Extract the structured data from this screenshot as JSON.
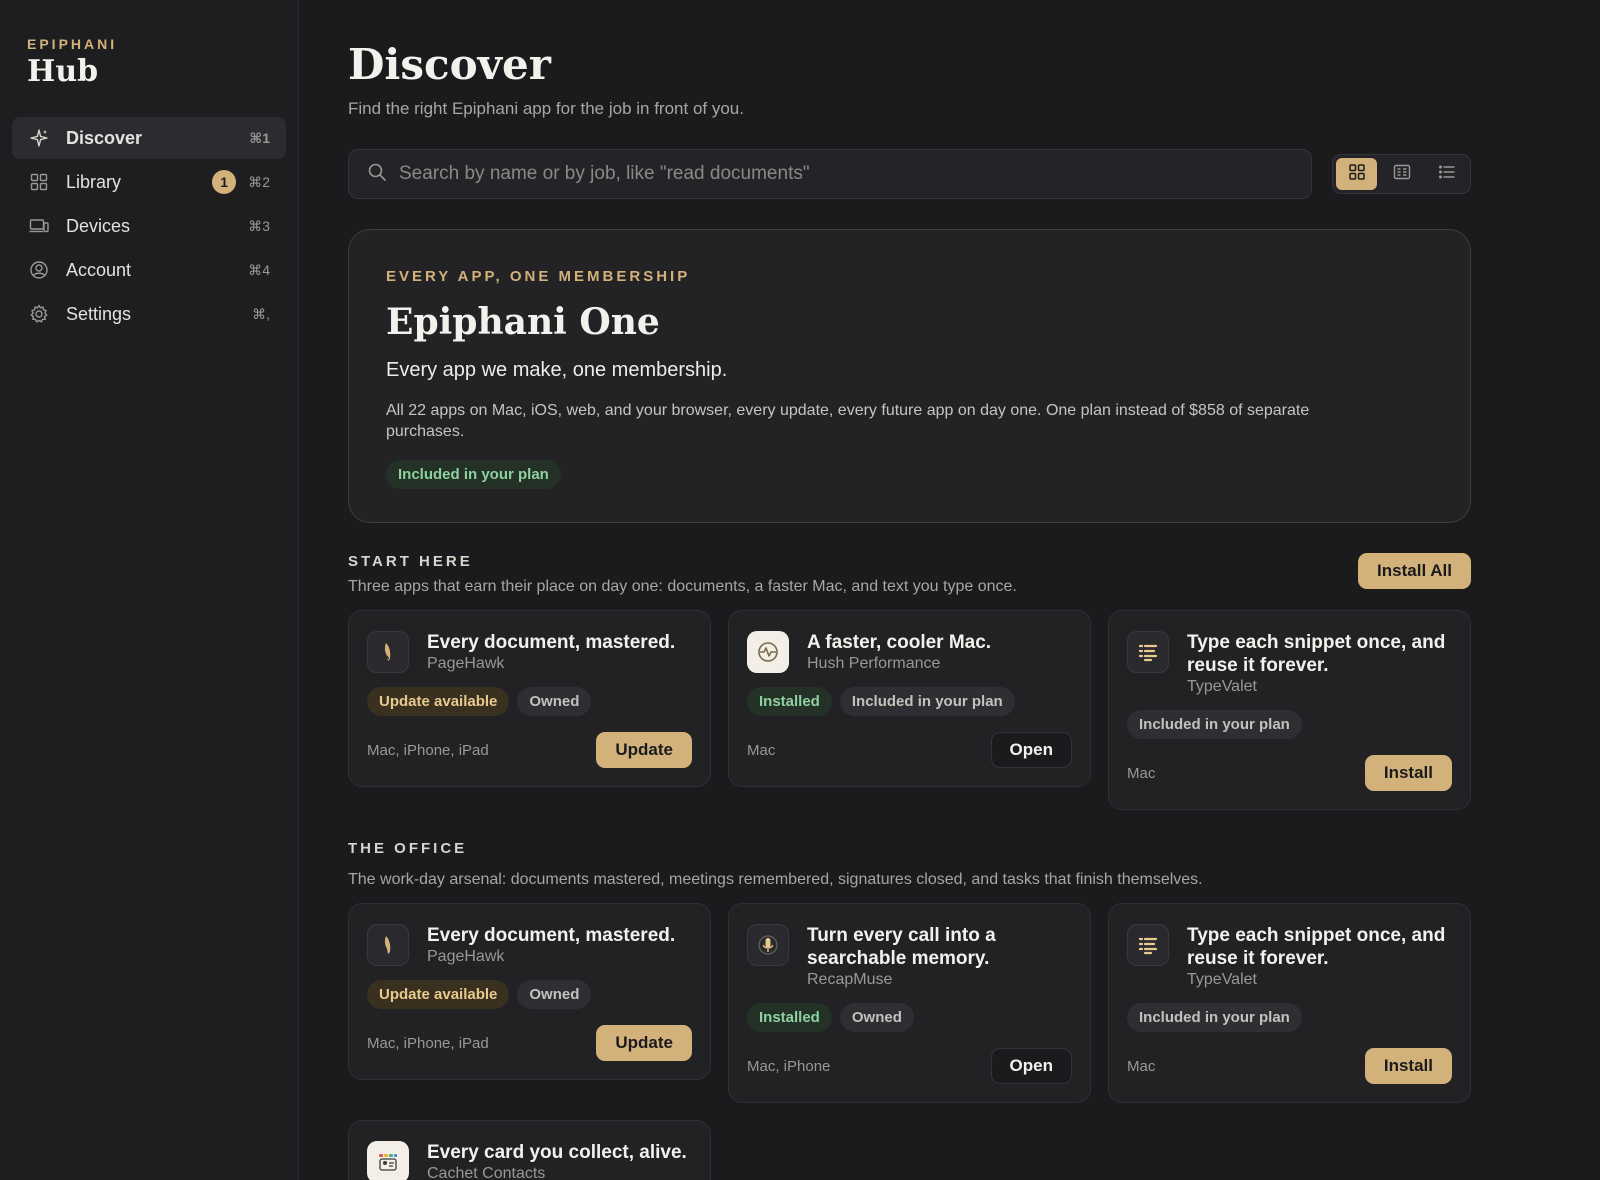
{
  "sidebar": {
    "brand_small": "EPIPHANI",
    "brand_big": "Hub",
    "items": [
      {
        "label": "Discover",
        "shortcut": "⌘1"
      },
      {
        "label": "Library",
        "shortcut": "⌘2",
        "badge": "1"
      },
      {
        "label": "Devices",
        "shortcut": "⌘3"
      },
      {
        "label": "Account",
        "shortcut": "⌘4"
      },
      {
        "label": "Settings",
        "shortcut": "⌘,"
      }
    ]
  },
  "header": {
    "title": "Discover",
    "subtitle": "Find the right Epiphani app for the job in front of you."
  },
  "search": {
    "placeholder": "Search by name or by job, like \"read documents\""
  },
  "hero": {
    "eyebrow": "EVERY APP, ONE MEMBERSHIP",
    "title": "Epiphani One",
    "tagline": "Every app we make, one membership.",
    "body": "All 22 apps on Mac, iOS, web, and your browser, every update, every future app on day one. One plan instead of $858 of separate purchases.",
    "pill": "Included in your plan"
  },
  "start_here": {
    "title": "START HERE",
    "desc": "Three apps that earn their place on day one: documents, a faster Mac, and text you type once.",
    "action": "Install All",
    "cards": [
      {
        "title": "Every document, mastered.",
        "app": "PageHawk",
        "pill1": "Update available",
        "pill2": "Owned",
        "platforms": "Mac, iPhone, iPad",
        "action": "Update"
      },
      {
        "title": "A faster, cooler Mac.",
        "app": "Hush Performance",
        "pill1": "Installed",
        "pill2": "Included in your plan",
        "platforms": "Mac",
        "action": "Open"
      },
      {
        "title": "Type each snippet once, and reuse it forever.",
        "app": "TypeValet",
        "pill1": "Included in your plan",
        "platforms": "Mac",
        "action": "Install"
      }
    ]
  },
  "office": {
    "title": "THE OFFICE",
    "desc": "The work-day arsenal: documents mastered, meetings remembered, signatures closed, and tasks that finish themselves.",
    "cards": [
      {
        "title": "Every document, mastered.",
        "app": "PageHawk",
        "pill1": "Update available",
        "pill2": "Owned",
        "platforms": "Mac, iPhone, iPad",
        "action": "Update"
      },
      {
        "title": "Turn every call into a searchable memory.",
        "app": "RecapMuse",
        "pill1": "Installed",
        "pill2": "Owned",
        "platforms": "Mac, iPhone",
        "action": "Open"
      },
      {
        "title": "Type each snippet once, and reuse it forever.",
        "app": "TypeValet",
        "pill1": "Included in your plan",
        "platforms": "Mac",
        "action": "Install"
      },
      {
        "title": "Every card you collect, alive.",
        "app": "Cachet Contacts"
      }
    ]
  },
  "colors": {
    "accent": "#d2b27a",
    "background": "#1b1b1e",
    "sidebar": "#1e1e21",
    "installed_green": "#8fd19e"
  }
}
